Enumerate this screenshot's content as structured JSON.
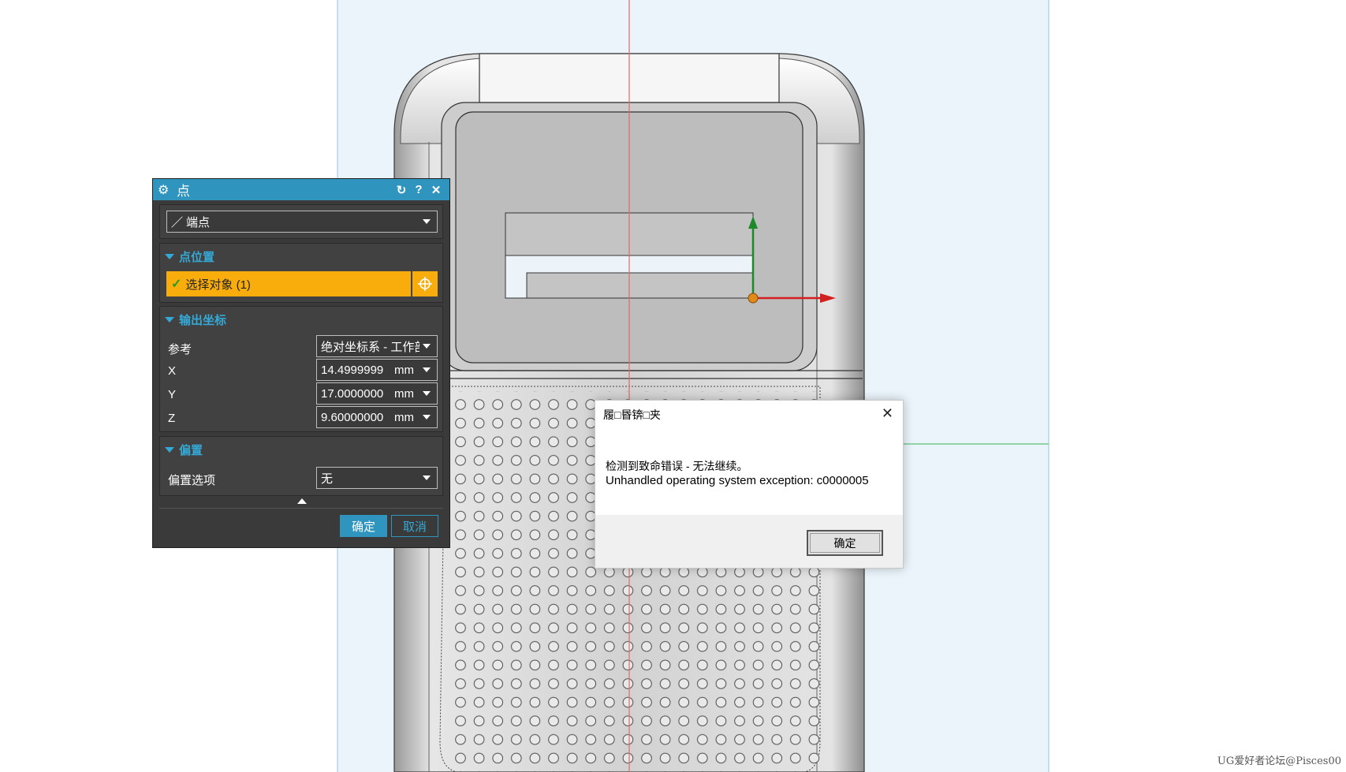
{
  "point_dialog": {
    "title": "点",
    "icons": {
      "settings": "gear-icon",
      "reset": "reset-icon",
      "help": "help-icon",
      "close": "close-icon"
    },
    "type_select": {
      "icon": "line-endpoint-icon",
      "value": "端点"
    },
    "section_point_location": {
      "title": "点位置",
      "select_object_label": "选择对象 (1)",
      "point_dialog_button_icon": "crosshair-icon"
    },
    "section_output_coords": {
      "title": "输出坐标",
      "reference_label": "参考",
      "reference_value": "绝对坐标系 - 工作部",
      "x_label": "X",
      "x_value": "14.4999999",
      "x_unit": "mm",
      "y_label": "Y",
      "y_value": "17.0000000",
      "y_unit": "mm",
      "z_label": "Z",
      "z_value": "9.60000000",
      "z_unit": "mm"
    },
    "section_offset": {
      "title": "偏置",
      "option_label": "偏置选项",
      "option_value": "无"
    },
    "ok_label": "确定",
    "cancel_label": "取消"
  },
  "error_dialog": {
    "title": "履□昬锛□夹",
    "message_line1": "检测到致命错误 - 无法继续。",
    "message_line2": "Unhandled operating system exception: c0000005",
    "ok_label": "确定"
  },
  "watermark": "UG爱好者论坛@Pisces00",
  "colors": {
    "dialog_bg": "#3a3a3a",
    "accent": "#2f95be",
    "selection": "#f9ad0c",
    "canvas_bg": "#eaf4fa"
  }
}
